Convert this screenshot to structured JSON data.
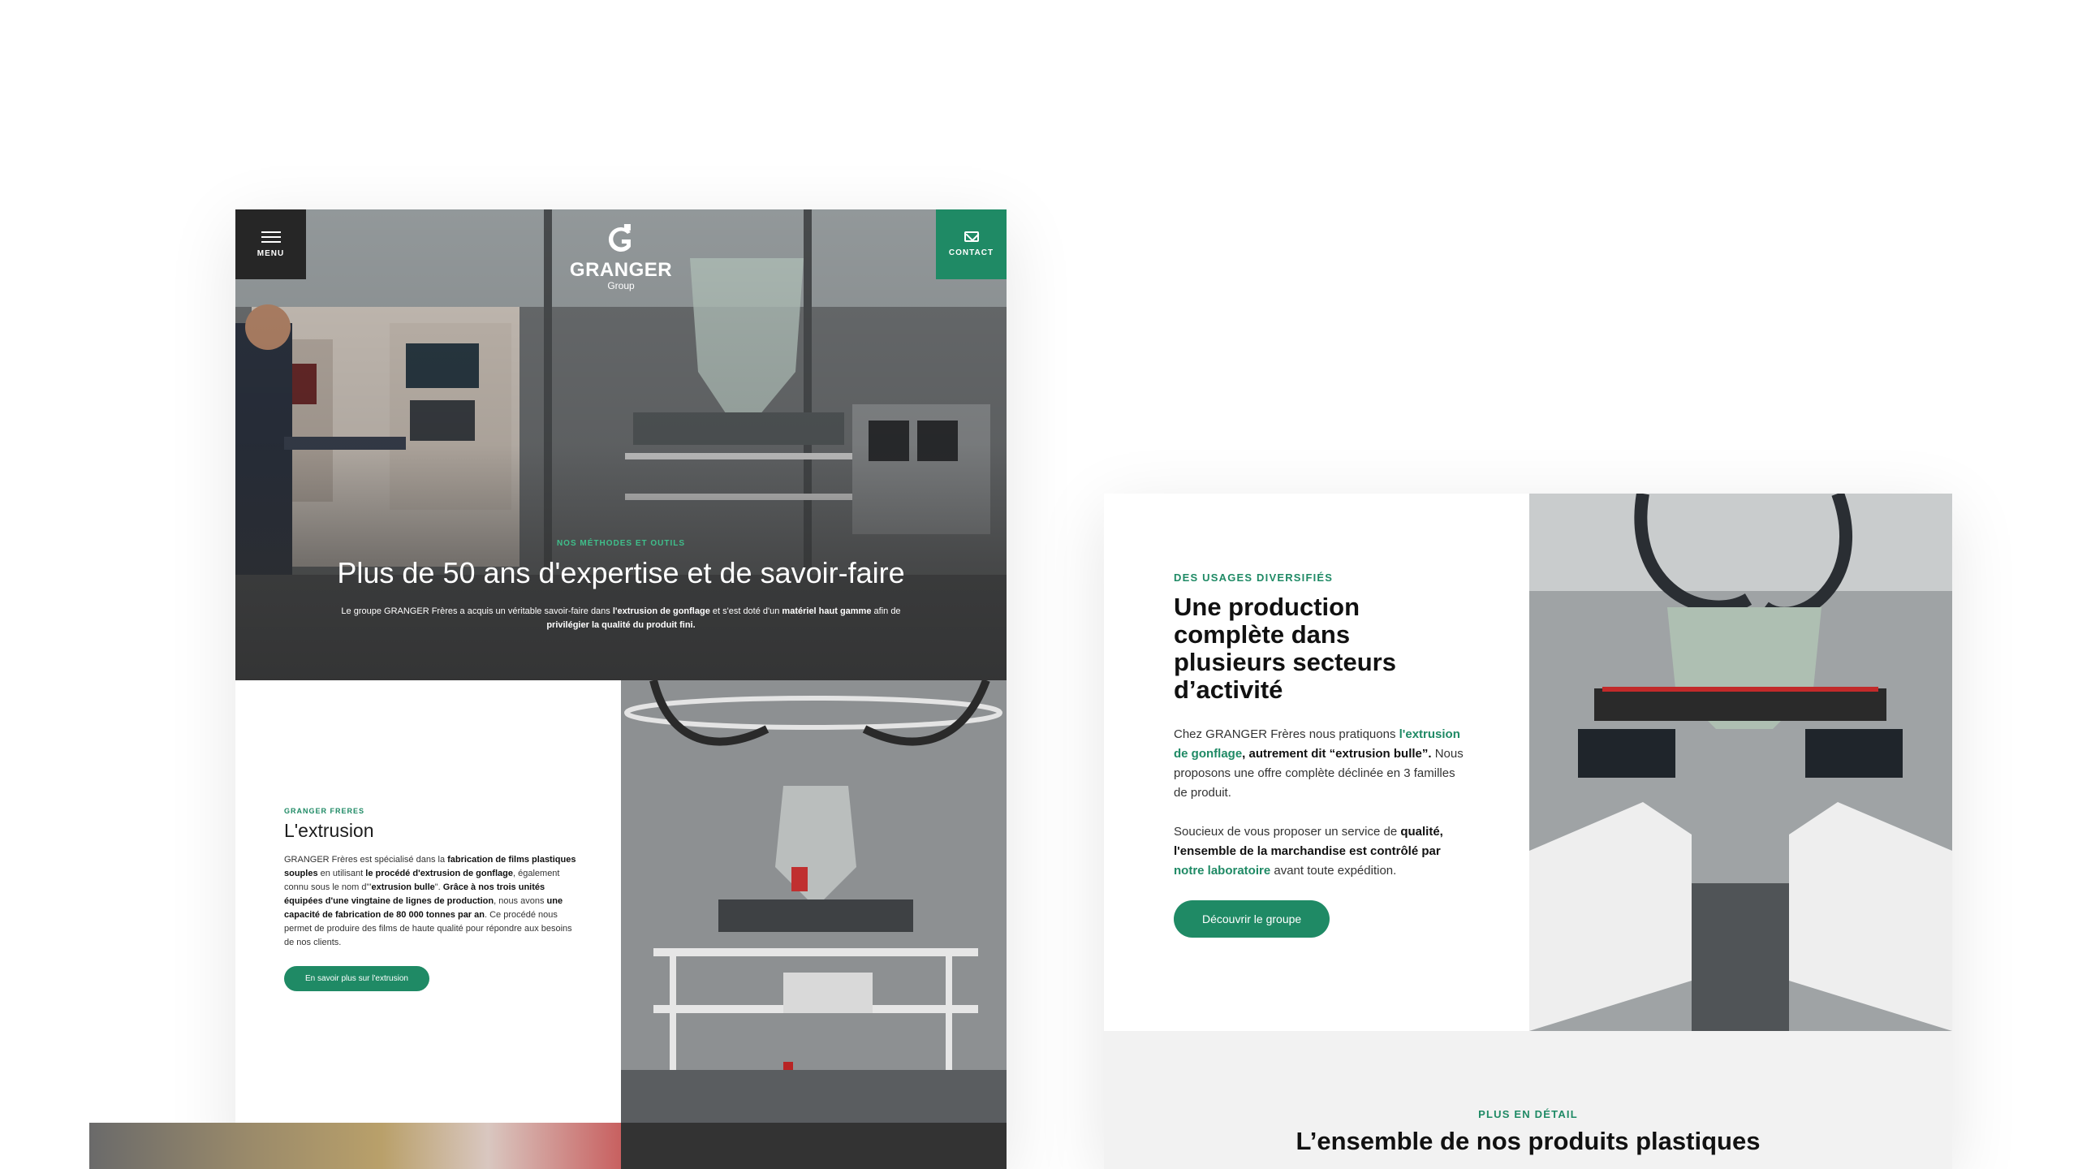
{
  "left_page": {
    "header": {
      "menu_label": "MENU",
      "contact_label": "CONTACT",
      "logo_name": "GRANGER",
      "logo_sub": "Group"
    },
    "hero": {
      "eyebrow": "NOS MÉTHODES ET OUTILS",
      "title": "Plus de 50 ans d'expertise et de savoir-faire",
      "desc_1": "Le groupe GRANGER Frères a acquis un véritable savoir-faire dans ",
      "desc_2": "l'extrusion de gonflage",
      "desc_3": " et s'est doté d'un ",
      "desc_4": "matériel haut gamme",
      "desc_5": " afin de ",
      "desc_6": "privilégier la qualité du produit fini."
    },
    "extrusion": {
      "eyebrow": "GRANGER FRERES",
      "title": "L'extrusion",
      "p1": "GRANGER Frères est spécialisé dans la ",
      "p2": "fabrication de films plastiques souples",
      "p3": " en utilisant ",
      "p4": "le procédé d'extrusion de gonflage",
      "p5": ", également connu sous le nom d'\"",
      "p6": "extrusion bulle",
      "p7": "\". ",
      "p8": "Grâce à nos trois unités équipées d'une vingtaine de lignes de production",
      "p9": ", nous avons ",
      "p10": "une capacité de fabrication de 80 000 tonnes par an",
      "p11": ". Ce procédé nous permet de produire des films de haute qualité pour répondre aux besoins de nos clients.",
      "button": "En savoir plus sur l'extrusion"
    }
  },
  "right_page": {
    "production": {
      "eyebrow": "DES USAGES DIVERSIFIÉS",
      "title": "Une production complète dans plusieurs secteurs d’activité",
      "p1a": "Chez GRANGER Frères nous pratiquons ",
      "p1b": "l'extrusion de gonflage",
      "p1c": ", autrement dit “extrusion bulle”.",
      "p1d": " Nous proposons une offre complète déclinée en 3 familles de produit.",
      "p2a": "Soucieux de vous proposer un service de ",
      "p2b": "qualité, l'ensemble de la marchandise est contrôlé par ",
      "p2c": "notre laboratoire",
      "p2d": " avant toute expédition.",
      "button": "Découvrir le groupe"
    },
    "detail": {
      "eyebrow": "PLUS EN DÉTAIL",
      "title": "L’ensemble de nos produits plastiques"
    }
  },
  "colors": {
    "brand_green": "#1f8a65",
    "menu_dark": "#262626",
    "footer_dark": "#333333"
  },
  "icons": [
    "hamburger-menu-icon",
    "mail-icon",
    "granger-logo-icon"
  ]
}
